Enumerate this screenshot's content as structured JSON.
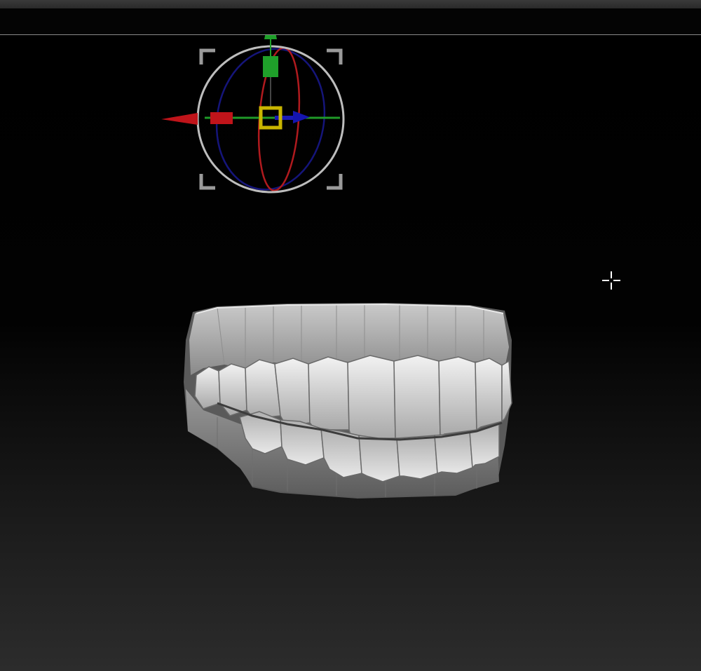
{
  "app": {
    "background": "#000000"
  },
  "gizmo": {
    "icon": "transform-gizmo-icon",
    "axis_colors": {
      "x": "#c0141a",
      "y": "#1fa02a",
      "z": "#1515a8",
      "center": "#c9b500",
      "ring": "#bdbdbd"
    }
  },
  "model": {
    "icon": "teeth-model",
    "color": "#bcbcbc"
  },
  "cursor": {
    "icon": "crosshair-cursor-icon"
  }
}
